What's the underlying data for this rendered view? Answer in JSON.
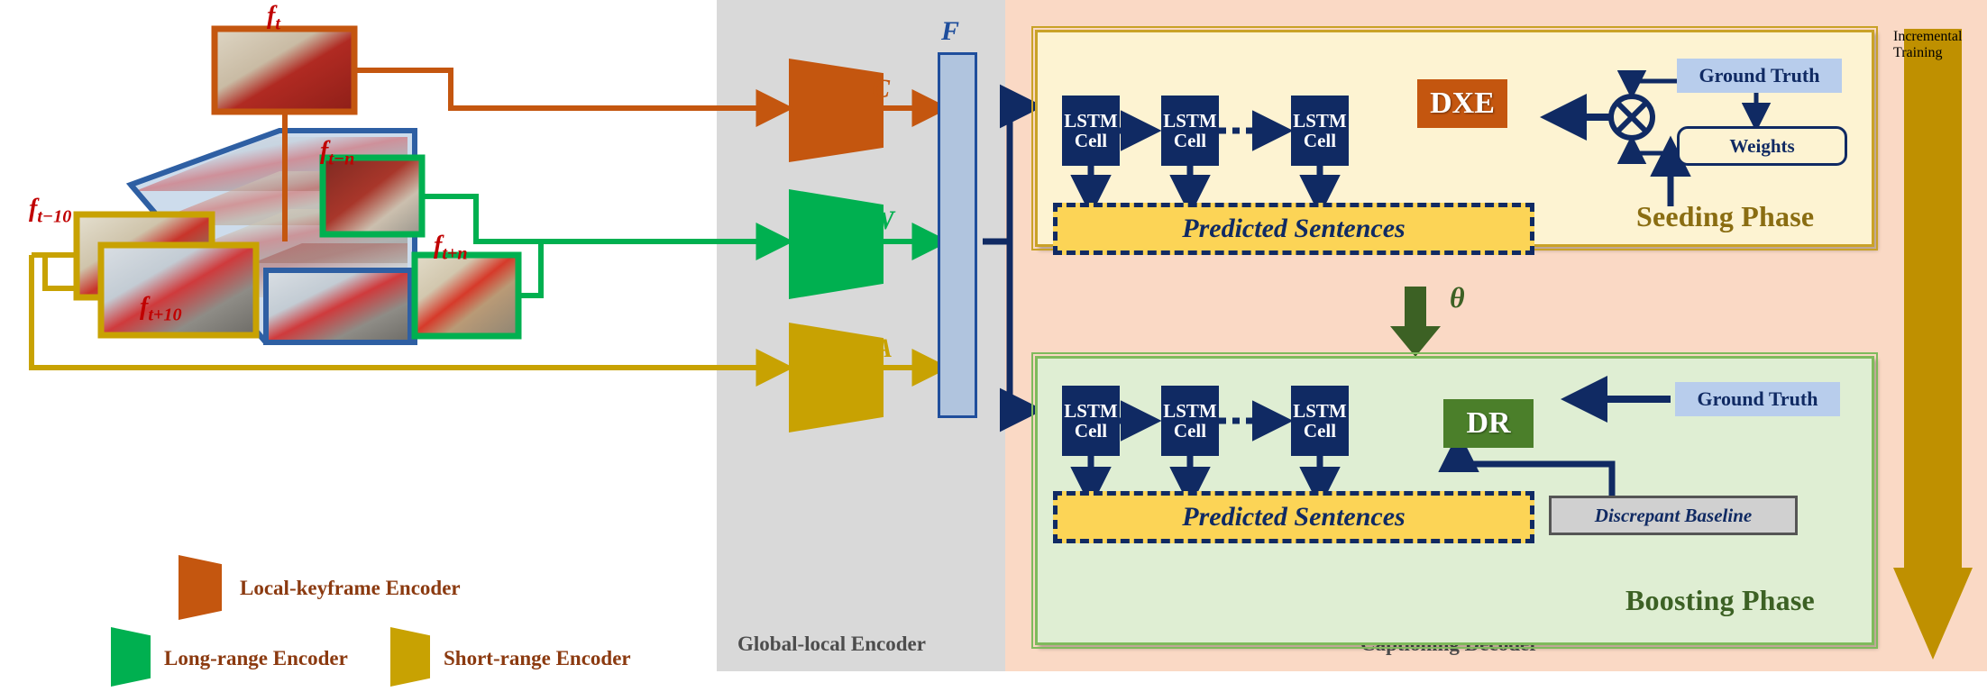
{
  "regions": {
    "encoder_caption": "Global-local Encoder",
    "decoder_caption": "Captioning Decoder"
  },
  "frames": {
    "keyframe_label": "f",
    "labels": [
      {
        "name": "keyframe",
        "base": "f",
        "sub": "t"
      },
      {
        "name": "long-range-prev",
        "base": "f",
        "sub": "t−n"
      },
      {
        "name": "long-range-next",
        "base": "f",
        "sub": "t+n"
      },
      {
        "name": "short-range-prev",
        "base": "f",
        "sub": "t−10"
      },
      {
        "name": "short-range-next",
        "base": "f",
        "sub": "t+10"
      }
    ]
  },
  "encoders": {
    "channels": [
      {
        "letter": "C",
        "color": "#c4560f",
        "name": "local-keyframe"
      },
      {
        "letter": "W",
        "color": "#00b050",
        "name": "long-range"
      },
      {
        "letter": "A",
        "color": "#c8a202",
        "name": "short-range"
      }
    ],
    "fusion_label": "F"
  },
  "legend": {
    "items": [
      {
        "label": "Local-keyframe Encoder",
        "color": "#c4560f"
      },
      {
        "label": "Long-range Encoder",
        "color": "#00b050"
      },
      {
        "label": "Short-range Encoder",
        "color": "#c8a202"
      }
    ]
  },
  "seeding": {
    "title": "Seeding Phase",
    "title_color": "#8a6d12",
    "cells": [
      "LSTM\nCell",
      "LSTM\nCell",
      "LSTM\nCell"
    ],
    "cell_line1": "LSTM",
    "cell_line2": "Cell",
    "ellipsis": "•••",
    "predicted": "Predicted Sentences",
    "loss": "DXE",
    "loss_color": "#c4560f",
    "ground_truth": "Ground Truth",
    "weights": "Weights",
    "operator": "⊗"
  },
  "transfer": {
    "symbol": "θ",
    "color": "#3c6124"
  },
  "boosting": {
    "title": "Boosting Phase",
    "title_color": "#3c6124",
    "cell_line1": "LSTM",
    "cell_line2": "Cell",
    "ellipsis": "•••",
    "predicted": "Predicted Sentences",
    "loss": "DR",
    "loss_color": "#4b7f2a",
    "ground_truth": "Ground Truth",
    "discrepant_baseline": "Discrepant Baseline"
  },
  "incremental_training": {
    "label": "Incremental Training",
    "color": "#bf9000"
  },
  "colors": {
    "encoder_panel": "#d9d9d9",
    "decoder_panel": "#fad9c5",
    "seeding_bg": "#fdf3d2",
    "seeding_border": "#c9a227",
    "boosting_bg": "#dfeed3",
    "boosting_border": "#7fba5c",
    "lstm": "#102a63",
    "predicted_bg": "#fcd456",
    "ground_truth_bg": "#b8cdec",
    "fusion_bar": "#b0c4de",
    "fusion_border": "#1f4e9c",
    "cube_blue": "#2e5fa3",
    "keyframe_orange": "#c4560f",
    "long_green": "#00b050",
    "short_gold": "#c8a202",
    "label_red": "#c00000"
  }
}
